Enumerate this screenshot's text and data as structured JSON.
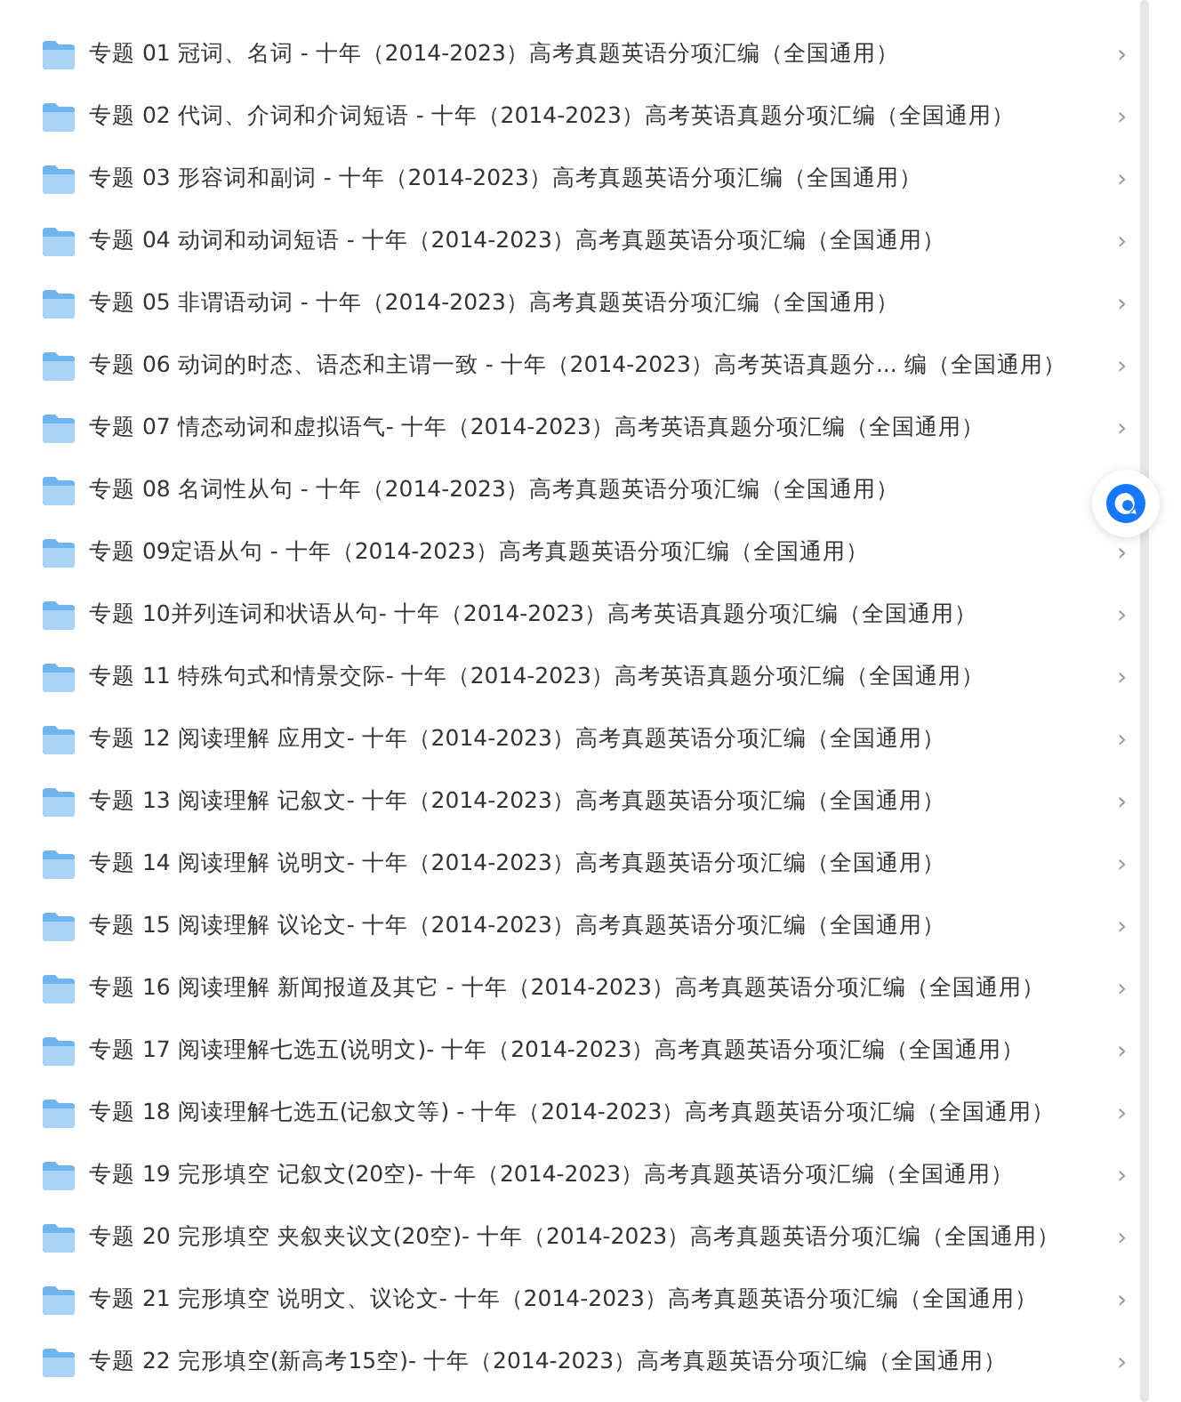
{
  "folders": [
    {
      "name": "专题 01 冠词、名词 - 十年（2014-2023）高考真题英语分项汇编（全国通用）",
      "chevron": "›"
    },
    {
      "name": "专题 02 代词、介词和介词短语 - 十年（2014-2023）高考英语真题分项汇编（全国通用）",
      "chevron": "›"
    },
    {
      "name": "专题 03 形容词和副词 - 十年（2014-2023）高考真题英语分项汇编（全国通用）",
      "chevron": "›"
    },
    {
      "name": "专题 04 动词和动词短语 - 十年（2014-2023）高考真题英语分项汇编（全国通用）",
      "chevron": "›"
    },
    {
      "name": "专题 05 非谓语动词  - 十年（2014-2023）高考真题英语分项汇编（全国通用）",
      "chevron": "›"
    },
    {
      "name": "专题 06 动词的时态、语态和主谓一致 - 十年（2014-2023）高考英语真题分... 编（全国通用）",
      "chevron": "›"
    },
    {
      "name": "专题 07 情态动词和虚拟语气- 十年（2014-2023）高考英语真题分项汇编（全国通用）",
      "chevron": "›"
    },
    {
      "name": "专题 08 名词性从句 - 十年（2014-2023）高考真题英语分项汇编（全国通用）"
    },
    {
      "name": "专题 09定语从句 - 十年（2014-2023）高考真题英语分项汇编（全国通用）",
      "chevron": "›"
    },
    {
      "name": "专题 10并列连词和状语从句- 十年（2014-2023）高考英语真题分项汇编（全国通用）",
      "chevron": "›"
    },
    {
      "name": "专题 11 特殊句式和情景交际- 十年（2014-2023）高考英语真题分项汇编（全国通用）",
      "chevron": "›"
    },
    {
      "name": "专题 12 阅读理解 应用文- 十年（2014-2023）高考真题英语分项汇编（全国通用）",
      "chevron": "›"
    },
    {
      "name": "专题 13 阅读理解 记叙文- 十年（2014-2023）高考真题英语分项汇编（全国通用）",
      "chevron": "›"
    },
    {
      "name": "专题 14 阅读理解 说明文- 十年（2014-2023）高考真题英语分项汇编（全国通用）",
      "chevron": "›"
    },
    {
      "name": "专题 15 阅读理解 议论文- 十年（2014-2023）高考真题英语分项汇编（全国通用）",
      "chevron": "›"
    },
    {
      "name": "专题 16 阅读理解 新闻报道及其它 - 十年（2014-2023）高考真题英语分项汇编（全国通用）",
      "chevron": "›"
    },
    {
      "name": "专题 17 阅读理解七选五(说明文)- 十年（2014-2023）高考真题英语分项汇编（全国通用）",
      "chevron": "›"
    },
    {
      "name": "专题 18 阅读理解七选五(记叙文等) - 十年（2014-2023）高考真题英语分项汇编（全国通用）",
      "chevron": "›"
    },
    {
      "name": "专题 19 完形填空 记叙文(20空)- 十年（2014-2023）高考真题英语分项汇编（全国通用）",
      "chevron": "›"
    },
    {
      "name": "专题 20 完形填空 夹叙夹议文(20空)- 十年（2014-2023）高考真题英语分项汇编（全国通用）",
      "chevron": "›"
    },
    {
      "name": "专题 21 完形填空 说明文、议论文- 十年（2014-2023）高考真题英语分项汇编（全国通用）",
      "chevron": "›"
    },
    {
      "name": "专题 22 完形填空(新高考15空)- 十年（2014-2023）高考真题英语分项汇编（全国通用）",
      "chevron": "›"
    }
  ]
}
